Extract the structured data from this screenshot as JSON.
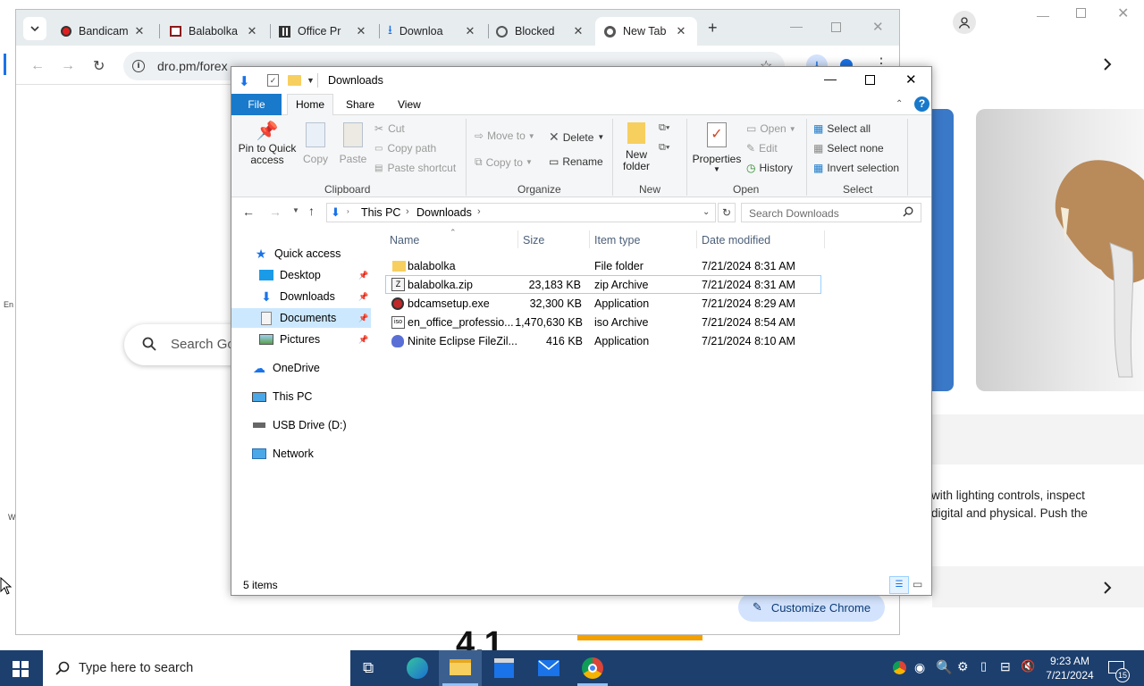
{
  "chrome": {
    "tabs": [
      {
        "label": "Bandicam"
      },
      {
        "label": "Balabolka"
      },
      {
        "label": "Office Pr"
      },
      {
        "label": "Downloa"
      },
      {
        "label": "Blocked"
      },
      {
        "label": "New Tab"
      }
    ],
    "url": "dro.pm/forex",
    "search_placeholder": "Search Go",
    "customize_label": "Customize Chrome"
  },
  "background_window": {
    "text_line1": "with lighting controls, inspect",
    "text_line2": "digital and physical. Push the",
    "partial_number": "4.1",
    "left_edge_text1": "En",
    "left_edge_text2": "W"
  },
  "explorer": {
    "title": "Downloads",
    "ribbon_tabs": [
      "File",
      "Home",
      "Share",
      "View"
    ],
    "clipboard": {
      "pin_line1": "Pin to Quick",
      "pin_line2": "access",
      "copy": "Copy",
      "paste": "Paste",
      "cut": "Cut",
      "copy_path": "Copy path",
      "paste_shortcut": "Paste shortcut",
      "group": "Clipboard"
    },
    "organize": {
      "move_to": "Move to",
      "copy_to": "Copy to",
      "delete": "Delete",
      "rename": "Rename",
      "group": "Organize"
    },
    "new": {
      "new_folder_line1": "New",
      "new_folder_line2": "folder",
      "group": "New"
    },
    "open": {
      "properties": "Properties",
      "open": "Open",
      "edit": "Edit",
      "history": "History",
      "group": "Open"
    },
    "select": {
      "select_all": "Select all",
      "select_none": "Select none",
      "invert": "Invert selection",
      "group": "Select"
    },
    "breadcrumb": [
      "This PC",
      "Downloads"
    ],
    "search_placeholder": "Search Downloads",
    "nav": {
      "quick_access": "Quick access",
      "desktop": "Desktop",
      "downloads": "Downloads",
      "documents": "Documents",
      "pictures": "Pictures",
      "onedrive": "OneDrive",
      "this_pc": "This PC",
      "usb": "USB Drive (D:)",
      "network": "Network"
    },
    "columns": {
      "name": "Name",
      "size": "Size",
      "type": "Item type",
      "date": "Date modified"
    },
    "files": [
      {
        "name": "balabolka",
        "size": "",
        "type": "File folder",
        "date": "7/21/2024 8:31 AM"
      },
      {
        "name": "balabolka.zip",
        "size": "23,183 KB",
        "type": "zip Archive",
        "date": "7/21/2024 8:31 AM"
      },
      {
        "name": "bdcamsetup.exe",
        "size": "32,300 KB",
        "type": "Application",
        "date": "7/21/2024 8:29 AM"
      },
      {
        "name": "en_office_professio...",
        "size": "1,470,630 KB",
        "type": "iso Archive",
        "date": "7/21/2024 8:54 AM"
      },
      {
        "name": "Ninite Eclipse FileZil...",
        "size": "416 KB",
        "type": "Application",
        "date": "7/21/2024 8:10 AM"
      }
    ],
    "status": "5 items"
  },
  "taskbar": {
    "search_placeholder": "Type here to search",
    "time": "9:23 AM",
    "date": "7/21/2024",
    "notification_count": "15"
  }
}
